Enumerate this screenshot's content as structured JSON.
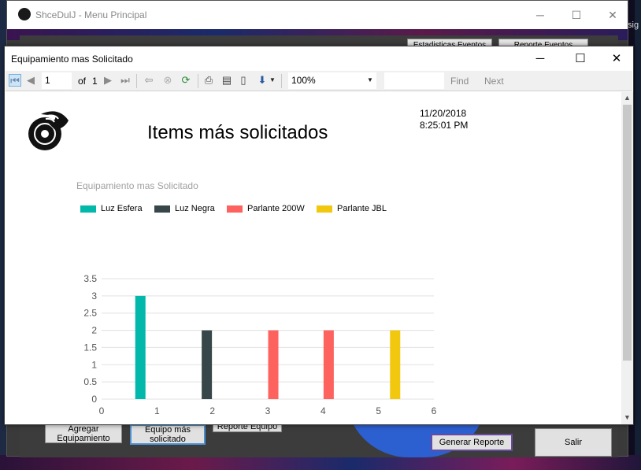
{
  "main_window": {
    "title": "ShceDulJ - Menu Principal",
    "caption_min": "─",
    "caption_max": "☐",
    "caption_close": "✕",
    "top_buttons": [
      "Estadisticas Eventos",
      "Reporte Eventos"
    ],
    "buttons": {
      "agregar": "Agregar Equipamiento",
      "equipo_mas": "Equipo más solicitado",
      "reporte_equipo": "Reporte Equipo",
      "generar_reporte": "Generar Reporte",
      "salir": "Salir"
    },
    "right_edge_text": "sig"
  },
  "report_window": {
    "title": "Equipamiento mas Solicitado",
    "caption_min": "─",
    "caption_max": "☐",
    "caption_close": "✕",
    "toolbar": {
      "page_current": "1",
      "page_of": "of",
      "page_total": "1",
      "zoom": "100%",
      "find_value": "",
      "find_label": "Find",
      "next_label": "Next",
      "icons": [
        "first-page-icon",
        "prev-page-icon",
        "next-page-icon",
        "last-page-icon",
        "back-icon",
        "stop-icon",
        "refresh-icon",
        "print-icon",
        "print-layout-icon",
        "page-setup-icon",
        "export-icon"
      ]
    },
    "report": {
      "title": "Items más solicitados",
      "date": "11/20/2018",
      "time": "8:25:01 PM"
    }
  },
  "chart_data": {
    "type": "bar",
    "title": "Equipamiento mas Solicitado",
    "xlabel": "",
    "ylabel": "",
    "ylim": [
      0,
      3.5
    ],
    "xlim": [
      0,
      6
    ],
    "yticks": [
      "0",
      "0.5",
      "1",
      "1.5",
      "2",
      "2.5",
      "3",
      "3.5"
    ],
    "xticks": [
      "0",
      "1",
      "2",
      "3",
      "4",
      "5",
      "6"
    ],
    "grid": true,
    "legend_position": "top",
    "series": [
      {
        "name": "Luz Esfera",
        "color": "#01b8aa",
        "points": [
          {
            "x": 0.7,
            "y": 3
          }
        ]
      },
      {
        "name": "Luz Negra",
        "color": "#374649",
        "points": [
          {
            "x": 1.9,
            "y": 2
          }
        ]
      },
      {
        "name": "Parlante 200W",
        "color": "#fd625e",
        "points": [
          {
            "x": 3.1,
            "y": 2
          },
          {
            "x": 4.1,
            "y": 2
          }
        ]
      },
      {
        "name": "Parlante JBL",
        "color": "#f2c80f",
        "points": [
          {
            "x": 5.3,
            "y": 2
          }
        ]
      }
    ]
  }
}
